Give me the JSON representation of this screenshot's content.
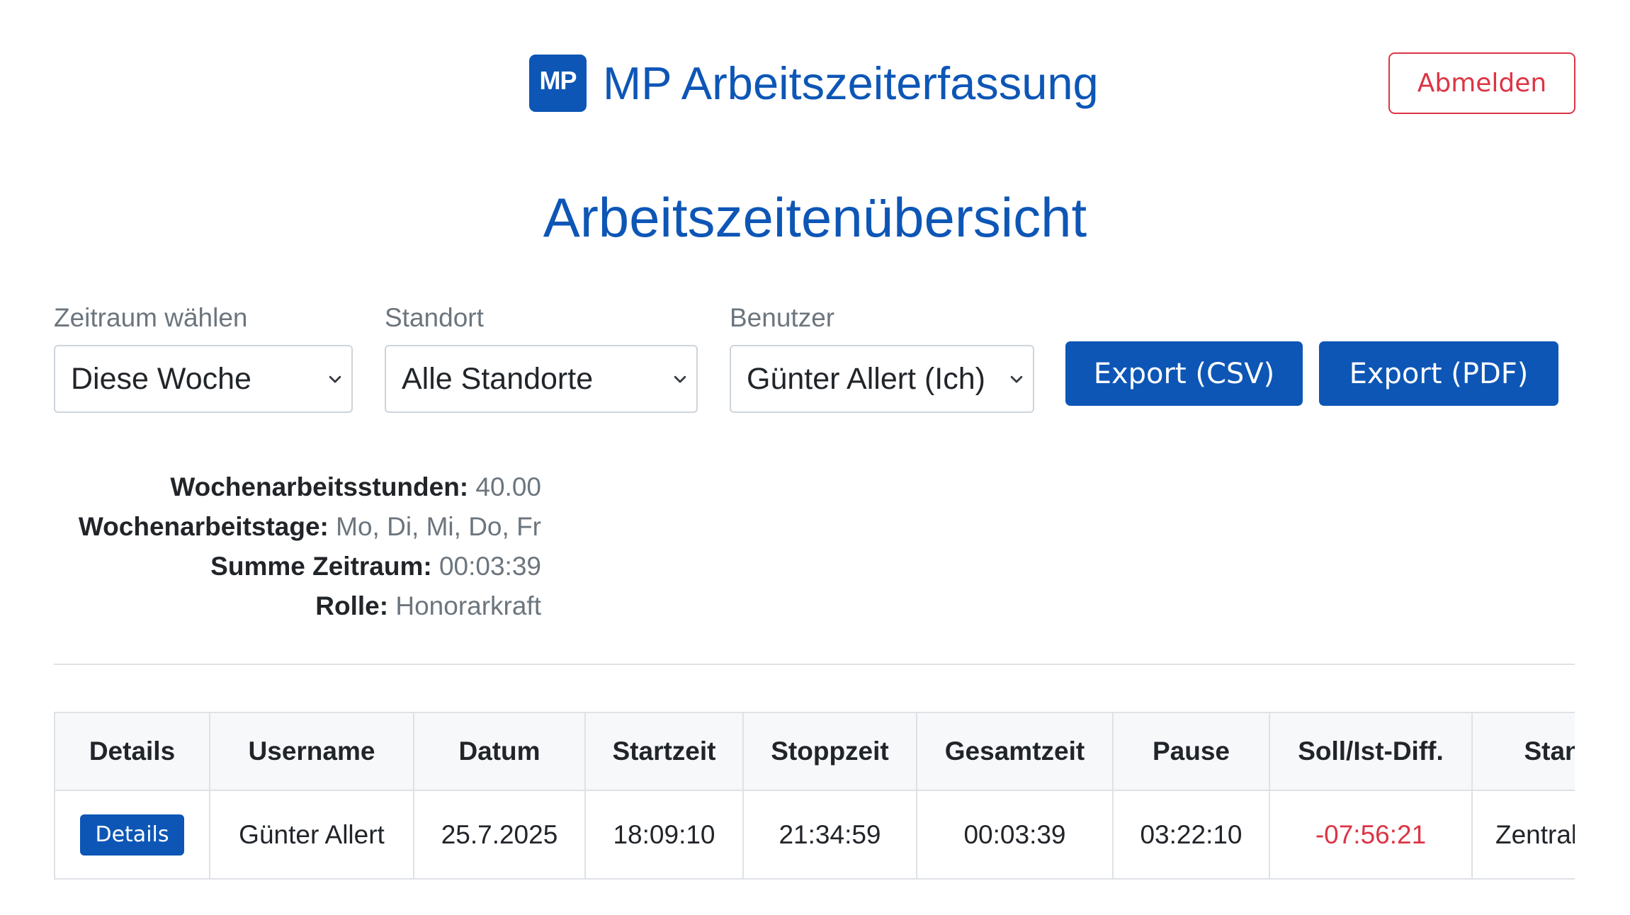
{
  "header": {
    "logo_text": "MP",
    "app_title": "MP Arbeitszeiterfassung",
    "logout_label": "Abmelden"
  },
  "page_title": "Arbeitszeitenübersicht",
  "filters": {
    "period": {
      "label": "Zeitraum wählen",
      "value": "Diese Woche"
    },
    "location": {
      "label": "Standort",
      "value": "Alle Standorte"
    },
    "user": {
      "label": "Benutzer",
      "value": "Günter Allert (Ich)"
    }
  },
  "actions": {
    "export_csv": "Export (CSV)",
    "export_pdf": "Export (PDF)"
  },
  "info": {
    "weekly_hours": {
      "label": "Wochenarbeitsstunden:",
      "value": "40.00"
    },
    "weekly_days": {
      "label": "Wochenarbeitstage:",
      "value": "Mo, Di, Mi, Do, Fr"
    },
    "period_sum": {
      "label": "Summe Zeitraum:",
      "value": "00:03:39"
    },
    "role": {
      "label": "Rolle:",
      "value": "Honorarkraft"
    }
  },
  "table": {
    "headers": [
      "Details",
      "Username",
      "Datum",
      "Startzeit",
      "Stoppzeit",
      "Gesamtzeit",
      "Pause",
      "Soll/Ist-Diff.",
      "Standort"
    ],
    "rows": [
      {
        "details_label": "Details",
        "username": "Günter Allert",
        "date": "25.7.2025",
        "start": "18:09:10",
        "stop": "21:34:59",
        "total": "00:03:39",
        "pause": "03:22:10",
        "diff": "-07:56:21",
        "location": "Zentrale"
      }
    ]
  },
  "colors": {
    "brand": "#0d56b6",
    "danger": "#dc3545",
    "muted": "#6c757d"
  }
}
